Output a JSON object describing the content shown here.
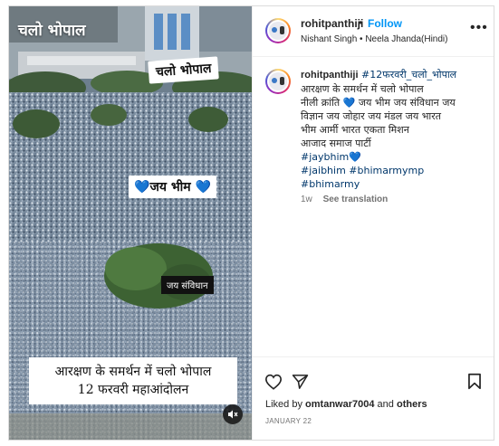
{
  "media": {
    "overlay_top": "चलो भोपाल",
    "overlay_bhopal": "चलो भोपाल",
    "overlay_jai_bhim_heart_left": "💙",
    "overlay_jai_bhim": "जय भीम",
    "overlay_jai_bhim_heart_right": "💙",
    "overlay_samvidhan": "जय संविधान",
    "overlay_bottom_line1": "आरक्षण के समर्थन में चलो भोपाल",
    "overlay_bottom_line2": "12 फरवरी महाआंदोलन",
    "mute_icon": "speaker-muted-icon"
  },
  "header": {
    "username": "rohitpanthiji",
    "separator": "•",
    "follow_label": "Follow",
    "subtitle": "Nishant Singh • Neela Jhanda(Hindi)",
    "more_icon": "more-horizontal-icon",
    "more_label": "•••"
  },
  "caption": {
    "username": "rohitpanthiji",
    "hashtag_main": "#12फरवरी_चलो_भोपाल",
    "lines": [
      "आरक्षण के समर्थन में चलो भोपाल",
      "नीली क्रांति",
      "जय भीम जय संविधान जय",
      "विज्ञान जय जोहार जय मंडल जय भारत",
      "भीम आर्मी भारत एकता मिशन",
      "आजाद समाज पार्टी"
    ],
    "heart": "💙",
    "tag_jaybhim": "#jaybhim",
    "tag_jaibhim": "#jaibhim",
    "tag_bhimarmymp": "#bhimarmymp",
    "tag_bhimarmy": "#bhimarmy",
    "age": "1w",
    "see_translation": "See translation"
  },
  "actions": {
    "like_icon": "heart-outline-icon",
    "share_icon": "paper-plane-icon",
    "save_icon": "bookmark-icon",
    "likes_prefix": "Liked by",
    "likes_user": "omtanwar7004",
    "likes_and": "and",
    "likes_others": "others",
    "date": "JANUARY 22"
  },
  "colors": {
    "follow": "#0095f6",
    "hashtag": "#00376b",
    "muted_text": "#737373",
    "border": "#dbdbdb",
    "heart_blue": "#2f8ff5"
  }
}
